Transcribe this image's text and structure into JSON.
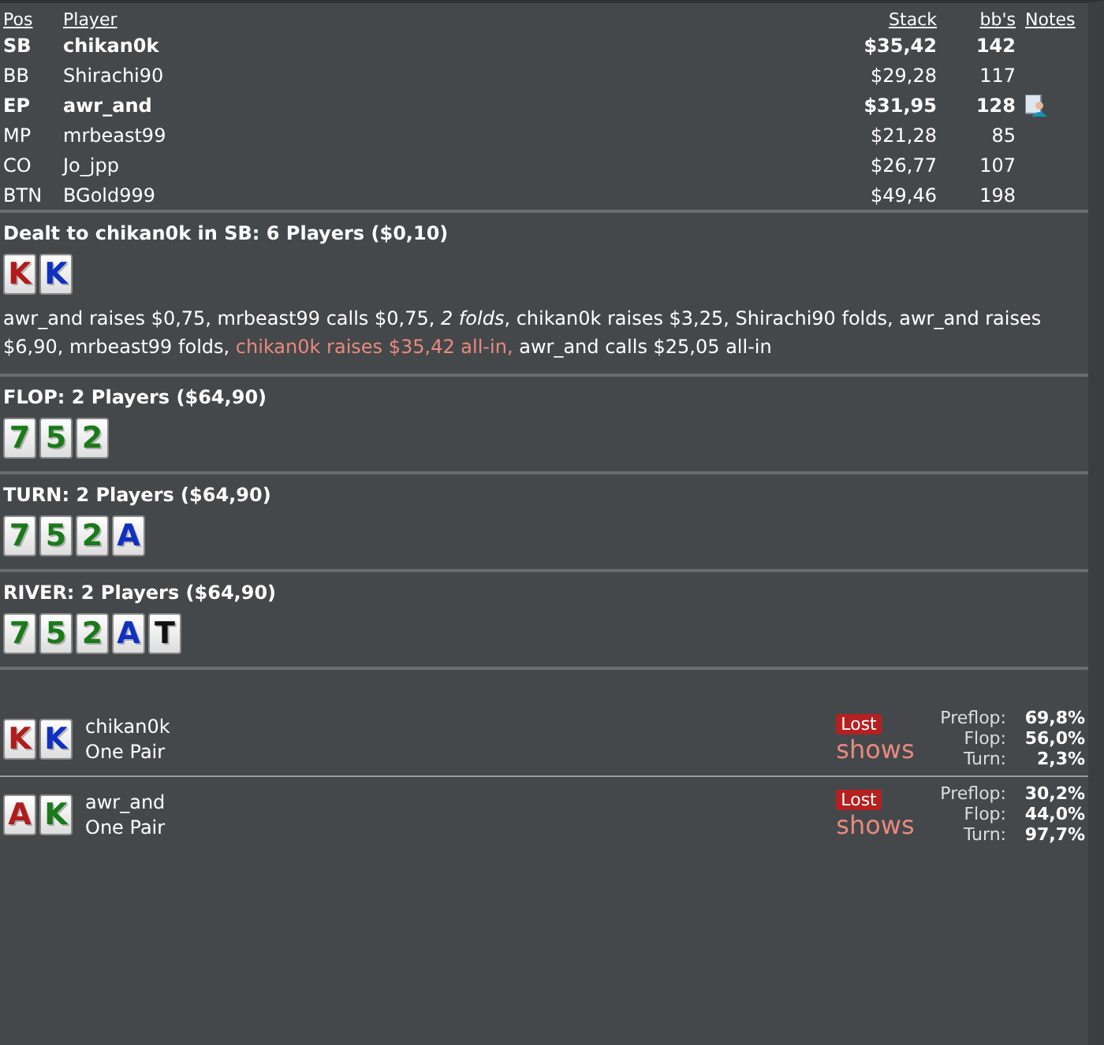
{
  "players": {
    "columns": [
      "Pos",
      "Player",
      "Stack",
      "bb's",
      "Notes"
    ],
    "rows": [
      {
        "pos": "SB",
        "name": "chikan0k",
        "stack": "$35,42",
        "bbs": "142",
        "bold": true,
        "has_note": false
      },
      {
        "pos": "BB",
        "name": "Shirachi90",
        "stack": "$29,28",
        "bbs": "117",
        "bold": false,
        "has_note": false
      },
      {
        "pos": "EP",
        "name": "awr_and",
        "stack": "$31,95",
        "bbs": "128",
        "bold": true,
        "has_note": true
      },
      {
        "pos": "MP",
        "name": "mrbeast99",
        "stack": "$21,28",
        "bbs": "85",
        "bold": false,
        "has_note": false
      },
      {
        "pos": "CO",
        "name": "Jo_jpp",
        "stack": "$26,77",
        "bbs": "107",
        "bold": false,
        "has_note": false
      },
      {
        "pos": "BTN",
        "name": "BGold999",
        "stack": "$49,46",
        "bbs": "198",
        "bold": false,
        "has_note": false
      }
    ]
  },
  "streets": [
    {
      "title": "Dealt to chikan0k in SB: 6 Players ($0,10)",
      "cards": [
        {
          "rank": "K",
          "color": "#b01c1c"
        },
        {
          "rank": "K",
          "color": "#1030c0"
        }
      ],
      "actions": [
        {
          "kind": "plain",
          "text": "awr_and raises $0,75, mrbeast99 calls $0,75, "
        },
        {
          "kind": "folds",
          "text": "2 folds"
        },
        {
          "kind": "plain",
          "text": ", chikan0k raises $3,25, Shirachi90 folds, awr_and raises $6,90, mrbeast99 folds, "
        },
        {
          "kind": "hero",
          "text": "chikan0k raises $35,42 all-in,"
        },
        {
          "kind": "plain",
          "text": " awr_and calls $25,05 all-in"
        }
      ]
    },
    {
      "title": "FLOP: 2 Players ($64,90)",
      "cards": [
        {
          "rank": "7",
          "color": "#1a7a1a"
        },
        {
          "rank": "5",
          "color": "#1a7a1a"
        },
        {
          "rank": "2",
          "color": "#1a7a1a"
        }
      ]
    },
    {
      "title": "TURN: 2 Players ($64,90)",
      "cards": [
        {
          "rank": "7",
          "color": "#1a7a1a"
        },
        {
          "rank": "5",
          "color": "#1a7a1a"
        },
        {
          "rank": "2",
          "color": "#1a7a1a"
        },
        {
          "rank": "A",
          "color": "#1030c0"
        }
      ]
    },
    {
      "title": "RIVER: 2 Players ($64,90)",
      "cards": [
        {
          "rank": "7",
          "color": "#1a7a1a"
        },
        {
          "rank": "5",
          "color": "#1a7a1a"
        },
        {
          "rank": "2",
          "color": "#1a7a1a"
        },
        {
          "rank": "A",
          "color": "#1030c0"
        },
        {
          "rank": "T",
          "color": "#111111"
        }
      ]
    }
  ],
  "showdown": [
    {
      "cards": [
        {
          "rank": "K",
          "color": "#b01c1c"
        },
        {
          "rank": "K",
          "color": "#1030c0"
        }
      ],
      "name": "chikan0k",
      "hand": "One Pair",
      "result": "Lost",
      "action": "shows",
      "equity": [
        {
          "label": "Preflop:",
          "value": "69,8%"
        },
        {
          "label": "Flop:",
          "value": "56,0%"
        },
        {
          "label": "Turn:",
          "value": "2,3%"
        }
      ]
    },
    {
      "cards": [
        {
          "rank": "A",
          "color": "#b01c1c"
        },
        {
          "rank": "K",
          "color": "#1a7a1a"
        }
      ],
      "name": "awr_and",
      "hand": "One Pair",
      "result": "Lost",
      "action": "shows",
      "equity": [
        {
          "label": "Preflop:",
          "value": "30,2%"
        },
        {
          "label": "Flop:",
          "value": "44,0%"
        },
        {
          "label": "Turn:",
          "value": "97,7%"
        }
      ]
    }
  ]
}
